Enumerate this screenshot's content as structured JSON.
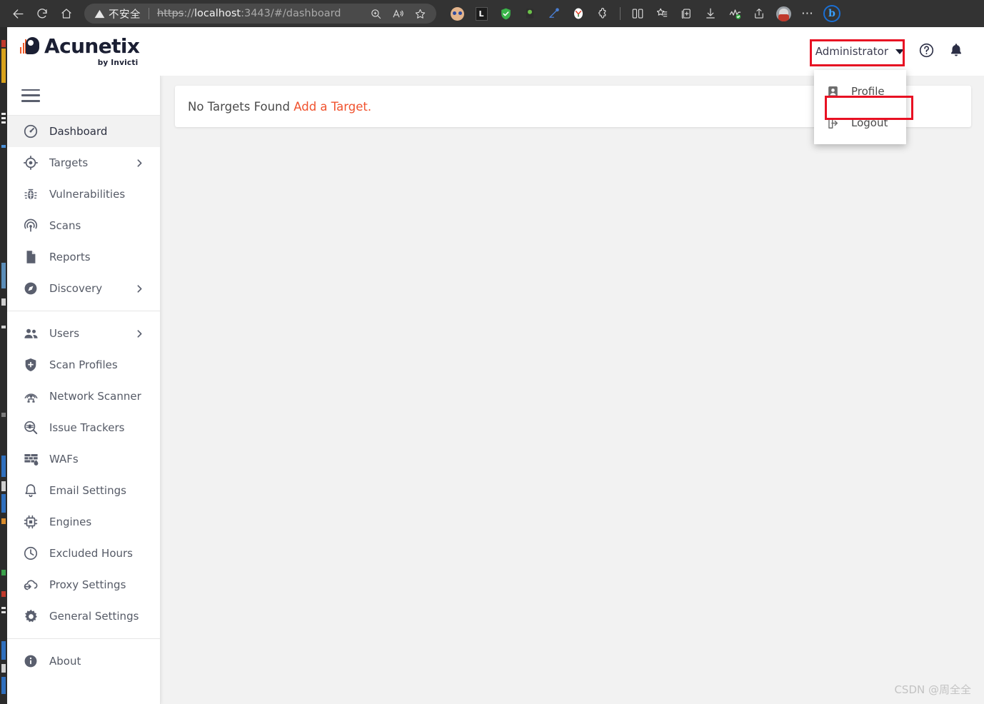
{
  "browser": {
    "back_icon": "back-arrow-icon",
    "reload_icon": "reload-icon",
    "home_icon": "home-icon",
    "security_warning": "不安全",
    "url_scheme": "https",
    "url_separator": "://",
    "url_host": "localhost",
    "url_rest": ":3443/#/dashboard",
    "zoom_icon": "zoom-in-icon",
    "read_aloud_icon": "read-aloud-icon",
    "favorite_icon": "star-icon",
    "extensions": [
      {
        "name": "monkey-extension-icon",
        "glyph": ""
      },
      {
        "name": "lastpass-extension-icon",
        "glyph": "L"
      },
      {
        "name": "adblock-shield-icon",
        "glyph": "✓"
      },
      {
        "name": "user-script-icon",
        "glyph": ""
      },
      {
        "name": "analytics-extension-icon",
        "glyph": ""
      },
      {
        "name": "yandex-extension-icon",
        "glyph": ""
      },
      {
        "name": "puzzle-extensions-icon",
        "glyph": ""
      },
      {
        "name": "split-screen-icon",
        "glyph": ""
      },
      {
        "name": "favorites-list-icon",
        "glyph": ""
      },
      {
        "name": "collections-icon",
        "glyph": ""
      },
      {
        "name": "downloads-icon",
        "glyph": ""
      },
      {
        "name": "browser-essentials-icon",
        "glyph": ""
      },
      {
        "name": "share-icon",
        "glyph": ""
      },
      {
        "name": "profile-avatar",
        "glyph": ""
      },
      {
        "name": "settings-more-icon",
        "glyph": "⋯"
      },
      {
        "name": "bing-copilot-icon",
        "glyph": "b"
      }
    ]
  },
  "app": {
    "brand_name": "Acunetix",
    "brand_subtitle": "by Invicti",
    "brand_color": "#f05a28",
    "brand_dark": "#1b1f33"
  },
  "topbar": {
    "user_name": "Administrator",
    "caret_icon": "chevron-down-icon",
    "help_icon": "help-circle-icon",
    "notifications_icon": "bell-icon",
    "highlight_color": "#e81123"
  },
  "user_dropdown": {
    "items": [
      {
        "label": "Profile",
        "icon": "user-badge-icon",
        "highlighted": true
      },
      {
        "label": "Logout",
        "icon": "logout-arrow-icon",
        "highlighted": false
      }
    ]
  },
  "sidebar": {
    "toggle_icon": "hamburger-menu-icon",
    "groups": [
      {
        "items": [
          {
            "label": "Dashboard",
            "icon": "speedometer-icon",
            "active": true,
            "expandable": false
          },
          {
            "label": "Targets",
            "icon": "crosshair-target-icon",
            "active": false,
            "expandable": true
          },
          {
            "label": "Vulnerabilities",
            "icon": "bug-icon",
            "active": false,
            "expandable": false
          },
          {
            "label": "Scans",
            "icon": "radar-scan-icon",
            "active": false,
            "expandable": false
          },
          {
            "label": "Reports",
            "icon": "document-icon",
            "active": false,
            "expandable": false
          },
          {
            "label": "Discovery",
            "icon": "compass-icon",
            "active": false,
            "expandable": true
          }
        ]
      },
      {
        "items": [
          {
            "label": "Users",
            "icon": "users-group-icon",
            "active": false,
            "expandable": true
          },
          {
            "label": "Scan Profiles",
            "icon": "shield-icon",
            "active": false,
            "expandable": false
          },
          {
            "label": "Network Scanner",
            "icon": "network-scanner-icon",
            "active": false,
            "expandable": false
          },
          {
            "label": "Issue Trackers",
            "icon": "magnifier-bug-icon",
            "active": false,
            "expandable": false
          },
          {
            "label": "WAFs",
            "icon": "firewall-brick-icon",
            "active": false,
            "expandable": false
          },
          {
            "label": "Email Settings",
            "icon": "bell-outline-icon",
            "active": false,
            "expandable": false
          },
          {
            "label": "Engines",
            "icon": "cpu-chip-icon",
            "active": false,
            "expandable": false
          },
          {
            "label": "Excluded Hours",
            "icon": "clock-icon",
            "active": false,
            "expandable": false
          },
          {
            "label": "Proxy Settings",
            "icon": "cloud-arrow-icon",
            "active": false,
            "expandable": false
          },
          {
            "label": "General Settings",
            "icon": "gear-icon",
            "active": false,
            "expandable": false
          }
        ]
      },
      {
        "items": [
          {
            "label": "About",
            "icon": "info-circle-icon",
            "active": false,
            "expandable": false
          }
        ]
      }
    ]
  },
  "main": {
    "empty_message": "No Targets Found",
    "empty_link": "Add a Target",
    "empty_period": ".",
    "link_color": "#f0522e"
  },
  "watermark": {
    "text": "CSDN @周全全"
  }
}
